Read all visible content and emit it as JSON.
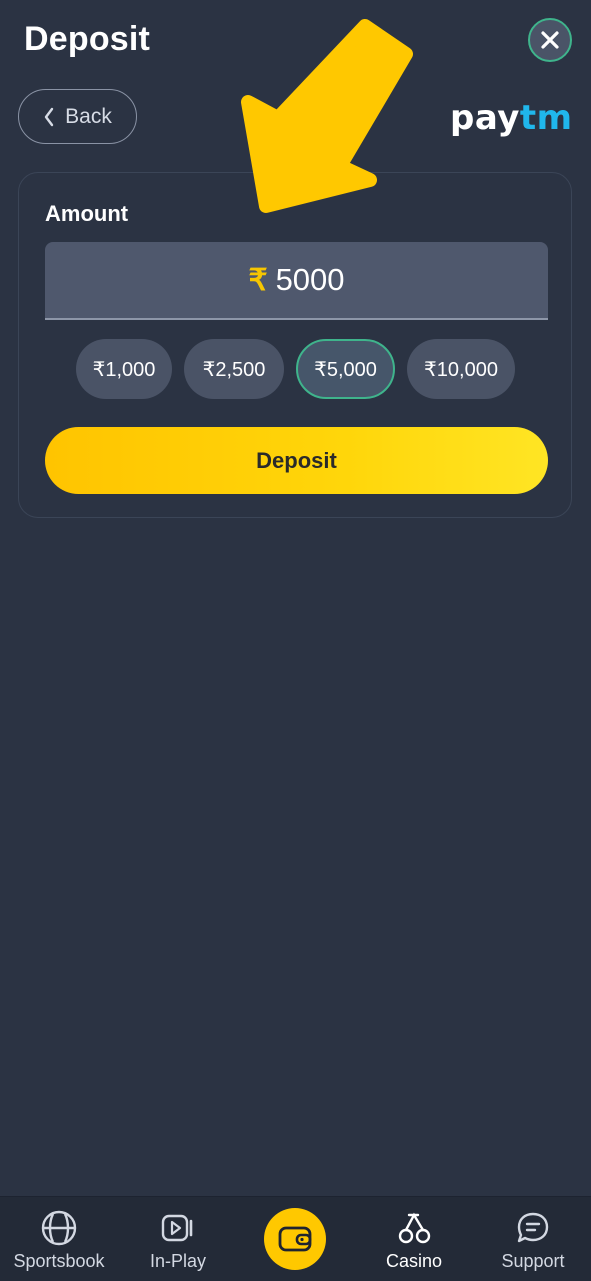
{
  "header": {
    "title": "Deposit",
    "back_label": "Back"
  },
  "provider": {
    "logo_pay": "pay",
    "logo_tm": "tm"
  },
  "form": {
    "amount_label": "Amount",
    "currency_symbol": "₹",
    "amount_value": "5000",
    "quick_amounts": [
      {
        "label": "₹1,000",
        "selected": false
      },
      {
        "label": "₹2,500",
        "selected": false
      },
      {
        "label": "₹5,000",
        "selected": true
      },
      {
        "label": "₹10,000",
        "selected": false
      }
    ],
    "submit_label": "Deposit"
  },
  "bottom_nav": {
    "items": [
      {
        "label": "Sportsbook",
        "icon": "basketball-icon"
      },
      {
        "label": "In-Play",
        "icon": "play-video-icon"
      },
      {
        "label": "",
        "icon": "wallet-icon"
      },
      {
        "label": "Casino",
        "icon": "cherries-icon"
      },
      {
        "label": "Support",
        "icon": "chat-icon"
      }
    ]
  },
  "colors": {
    "accent": "#ffc800",
    "selected_border": "#3fb48c",
    "background": "#2b3343"
  }
}
